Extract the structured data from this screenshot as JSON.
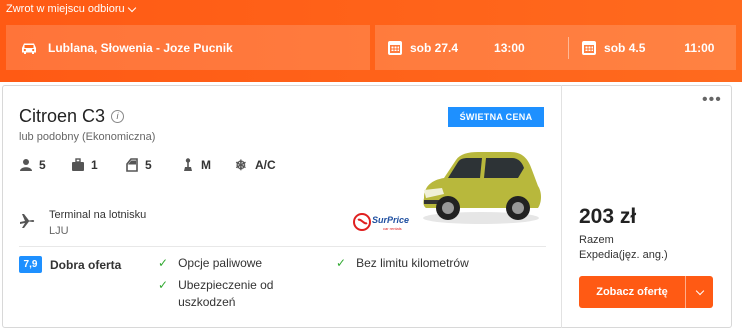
{
  "search": {
    "return_label": "Zwrot w miejscu odbioru",
    "location": "Lublana, Słowenia - Joze Pucnik",
    "pickup_date": "sob 27.4",
    "pickup_time": "13:00",
    "dropoff_date": "sob 4.5",
    "dropoff_time": "11:00"
  },
  "offer": {
    "car_name": "Citroen C3",
    "subtitle": "lub podobny (Ekonomiczna)",
    "badge": "ŚWIETNA CENA",
    "features": [
      {
        "icon": "person-icon",
        "value": "5"
      },
      {
        "icon": "suitcase-icon",
        "value": "1"
      },
      {
        "icon": "door-icon",
        "value": "5"
      },
      {
        "icon": "gearshift-icon",
        "value": "M"
      },
      {
        "icon": "snowflake-icon",
        "value": "A/C"
      }
    ],
    "pickup_location": "Terminal na lotnisku",
    "pickup_code": "LJU",
    "supplier_logo_text": "SurPrice car rentals",
    "score": "7,9",
    "score_label": "Dobra oferta",
    "perks": [
      "Opcje paliwowe",
      "Bez limitu kilometrów",
      "Ubezpieczenie od uszkodzeń"
    ],
    "price": "203 zł",
    "price_total_label": "Razem",
    "provider": "Expedia(jęz. ang.)",
    "cta_label": "Zobacz ofertę"
  },
  "colors": {
    "accent": "#ff5a14",
    "badge": "#1e90ff",
    "check": "#33aa33"
  }
}
